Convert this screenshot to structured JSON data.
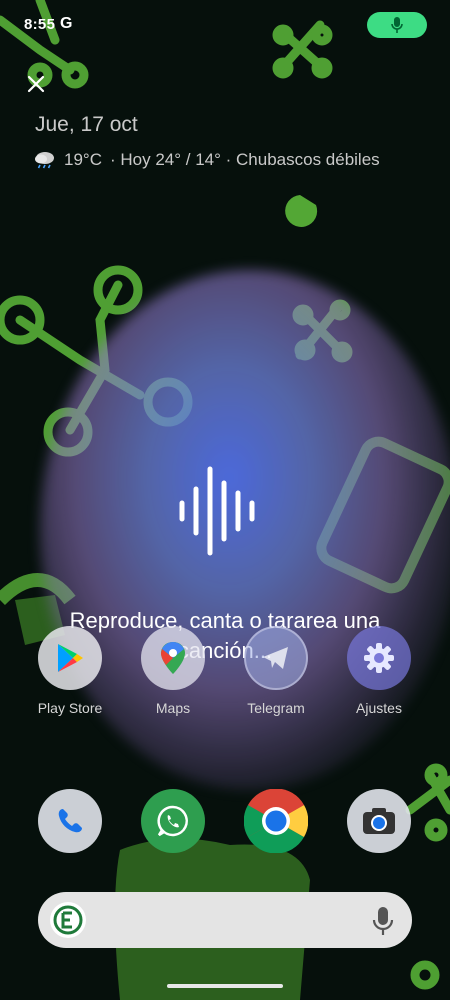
{
  "status": {
    "time": "8:55",
    "g_label": "G",
    "mic_indicator_color": "#3ddc84"
  },
  "at_a_glance": {
    "date": "Jue, 17 oct",
    "weather_icon": "cloud-rain-icon",
    "temperature": "19°C",
    "forecast": "· Hoy 24° / 14° · Chubascos débiles"
  },
  "song_search": {
    "prompt": "Reproduce, canta o tararea una canción...",
    "wave_icon": "audio-wave-icon"
  },
  "apps_row": [
    {
      "label": "Play Store",
      "icon": "play-store-icon"
    },
    {
      "label": "Maps",
      "icon": "maps-icon"
    },
    {
      "label": "Telegram",
      "icon": "telegram-icon"
    },
    {
      "label": "Ajustes",
      "icon": "settings-gear-icon"
    }
  ],
  "dock": [
    {
      "icon": "phone-icon"
    },
    {
      "icon": "whatsapp-icon"
    },
    {
      "icon": "chrome-icon"
    },
    {
      "icon": "camera-icon"
    }
  ],
  "search_bar": {
    "left_icon": "google-icon",
    "right_icon": "mic-icon"
  },
  "colors": {
    "accent_green": "#3ddc84",
    "wallpaper_bg": "#06100c",
    "wallpaper_shapes": "#5cb83a"
  }
}
